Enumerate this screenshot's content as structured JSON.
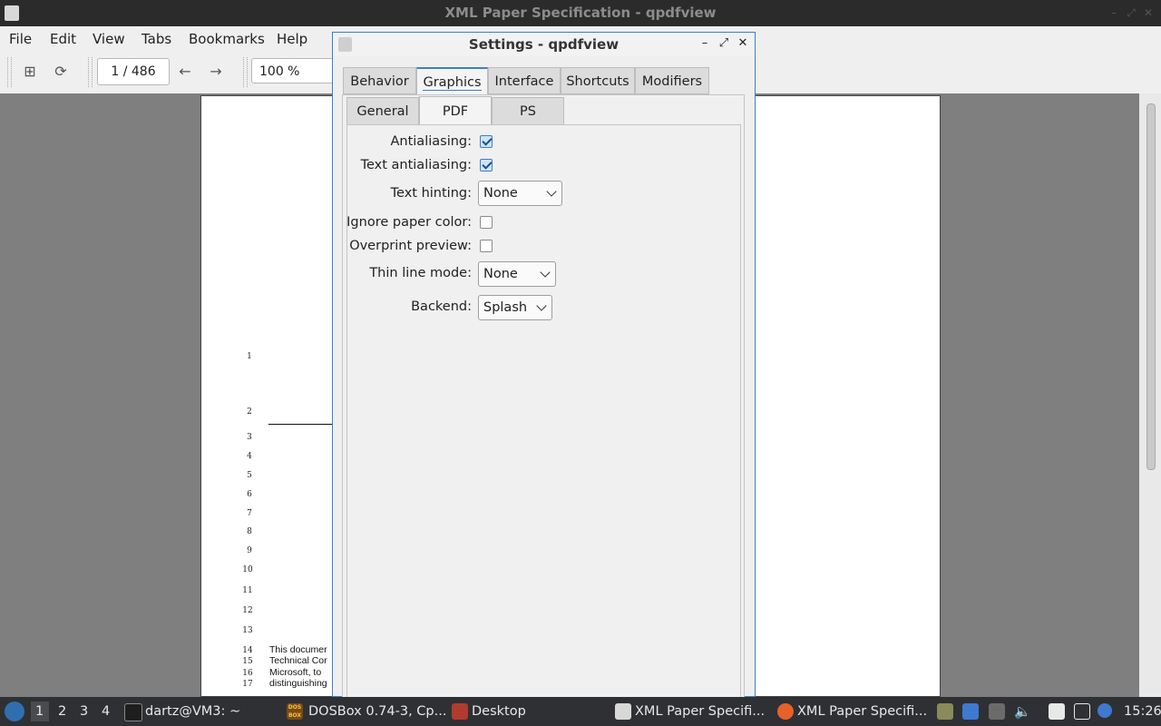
{
  "window": {
    "title": "XML Paper Specification - qpdfview"
  },
  "menubar": {
    "items": [
      "File",
      "Edit",
      "View",
      "Tabs",
      "Bookmarks",
      "Help"
    ]
  },
  "toolbar": {
    "page_field": "1 / 486",
    "zoom_field": "100 %"
  },
  "document": {
    "line_numbers": [
      "1",
      "2",
      "3",
      "4",
      "5",
      "6",
      "7",
      "8",
      "9",
      "10",
      "11",
      "12",
      "13",
      "14",
      "15",
      "16",
      "17"
    ],
    "text_lines": [
      "This documer",
      "Technical Cor",
      "Microsoft, to",
      "distinguishing"
    ]
  },
  "dialog": {
    "title": "Settings - qpdfview",
    "tabs": [
      "Behavior",
      "Graphics",
      "Interface",
      "Shortcuts",
      "Modifiers"
    ],
    "active_tab": "Graphics",
    "subtabs": [
      "General",
      "PDF",
      "PS"
    ],
    "active_subtab": "PDF",
    "fields": {
      "antialiasing": {
        "label": "Antialiasing:",
        "checked": true
      },
      "text_antialiasing": {
        "label": "Text antialiasing:",
        "checked": true
      },
      "text_hinting": {
        "label": "Text hinting:",
        "value": "None"
      },
      "ignore_paper_color": {
        "label": "Ignore paper color:",
        "checked": false
      },
      "overprint_preview": {
        "label": "Overprint preview:",
        "checked": false
      },
      "thin_line_mode": {
        "label": "Thin line mode:",
        "value": "None"
      },
      "backend": {
        "label": "Backend:",
        "value": "Splash"
      }
    }
  },
  "taskbar": {
    "workspaces": [
      "1",
      "2",
      "3",
      "4"
    ],
    "tasks": [
      "dartz@VM3: ~",
      "DOSBox 0.74-3, Cp...",
      "Desktop",
      "XML Paper Specifi...",
      "XML Paper Specifi..."
    ],
    "dosbox_icon_text": "DOS BOX",
    "clock": "15:26"
  },
  "colors": {
    "accent": "#3c80c8",
    "taskbar": "#2f3033",
    "viewport": "#7f7f7f"
  }
}
